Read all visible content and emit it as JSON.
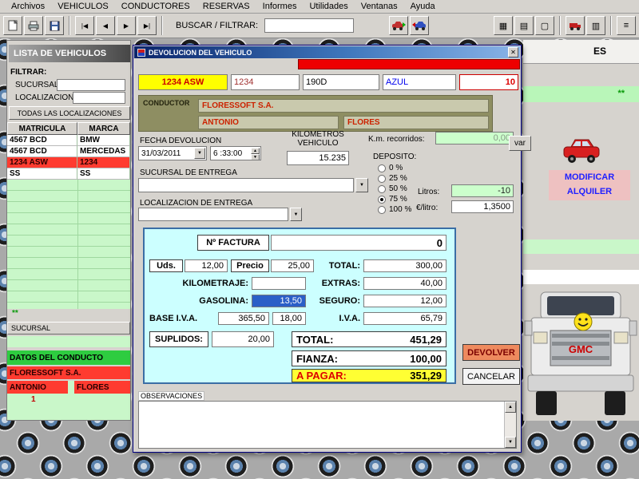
{
  "menu": {
    "items": [
      "Archivos",
      "VEHICULOS",
      "CONDUCTORES",
      "RESERVAS",
      "Informes",
      "Utilidades",
      "Ventanas",
      "Ayuda"
    ]
  },
  "toolbar": {
    "search_label": "BUSCAR / FILTRAR:",
    "search_value": ""
  },
  "icons": {
    "nav_first": "|◀",
    "nav_prev": "◀",
    "nav_next": "▶",
    "nav_last": "▶|",
    "combo_arrow": "▼",
    "spinner_up": "▲",
    "spinner_down": "▼",
    "close": "✕",
    "grid": "▦",
    "cells": "▤",
    "box": "▢",
    "columns": "▥",
    "list": "≡",
    "scroll_up": "▲",
    "scroll_down": "▼"
  },
  "vehicle_list": {
    "title": "LISTA DE VEHICULOS",
    "filter_label": "FILTRAR:",
    "sucursal_label": "SUCURSAL:",
    "localizacion_label": "LOCALIZACION",
    "all_locations_button": "TODAS LAS LOCALIZACIONES",
    "columns": [
      "MATRICULA",
      "MARCA"
    ],
    "rows": [
      {
        "matricula": "4567 BCD",
        "marca": "BMW",
        "selected": false
      },
      {
        "matricula": "4567 BCD",
        "marca": "MERCEDAS",
        "selected": false
      },
      {
        "matricula": "1234 ASW",
        "marca": "1234",
        "selected": true
      },
      {
        "matricula": "SS",
        "marca": "SS",
        "selected": false
      }
    ],
    "stars": "**",
    "sucursal_footer": "SUCURSAL"
  },
  "driver_panel": {
    "title": "DATOS DEL CONDUCTO",
    "company": "FLORESSOFT S.A.",
    "first_name": "ANTONIO",
    "last_name": "FLORES",
    "count": "1"
  },
  "right_panel": {
    "tab_text": "ES",
    "stars": "**",
    "var_button": "var",
    "modify_line1": "MODIFICAR",
    "modify_line2": "ALQUILER",
    "truck_brand": "GMC"
  },
  "dialog": {
    "title": "DEVOLUCION DEL VEHICULO",
    "plate": "1234 ASW",
    "unit_number": "1234",
    "model": "190D",
    "color": "AZUL",
    "days": "10",
    "conductor": {
      "label": "CONDUCTOR",
      "company": "FLORESSOFT S.A.",
      "first": "ANTONIO",
      "last": "FLORES"
    },
    "fecha_label": "FECHA DEVOLUCION",
    "fecha": "31/03/2011",
    "hora": "6 :33:00",
    "km_line1": "KILOMETROS",
    "km_line2": "VEHICULO",
    "km_value": "15.235",
    "km_recorridos_label": "K.m. recorridos:",
    "km_recorridos_value": "0,00",
    "deposito_label": "DEPOSITO:",
    "deposito_options": [
      "0 %",
      "25 %",
      "50 %",
      "75 %",
      "100 %"
    ],
    "deposito_selected": "75 %",
    "sucursal_entrega_label": "SUCURSAL DE ENTREGA",
    "localizacion_entrega_label": "LOCALIZACION DE ENTREGA",
    "litros_label": "Litros:",
    "litros_value": "-10",
    "euro_litro_label": "€/litro:",
    "euro_litro_value": "1,3500",
    "invoice": {
      "factura_label": "Nº FACTURA",
      "factura_value": "0",
      "uds_label": "Uds.",
      "uds_value": "12,00",
      "precio_label": "Precio",
      "precio_value": "25,00",
      "total_label": "TOTAL:",
      "total_value": "300,00",
      "kilometraje_label": "KILOMETRAJE:",
      "kilometraje_value": "",
      "extras_label": "EXTRAS:",
      "extras_value": "40,00",
      "gasolina_label": "GASOLINA:",
      "gasolina_value": "13,50",
      "seguro_label": "SEGURO:",
      "seguro_value": "12,00",
      "base_iva_label": "BASE I.V.A.",
      "base_iva_value": "365,50",
      "iva_pct_value": "18,00",
      "iva_label": "I.V.A.",
      "iva_value": "65,79",
      "suplidos_label": "SUPLIDOS:",
      "suplidos_value": "20,00",
      "gran_total_label": "TOTAL:",
      "gran_total_value": "451,29",
      "fianza_label": "FIANZA:",
      "fianza_value": "100,00",
      "a_pagar_label": "A PAGAR:",
      "a_pagar_value": "351,29"
    },
    "devolver_button": "DEVOLVER",
    "cancelar_button": "CANCELAR",
    "observaciones_label": "OBSERVACIONES"
  }
}
